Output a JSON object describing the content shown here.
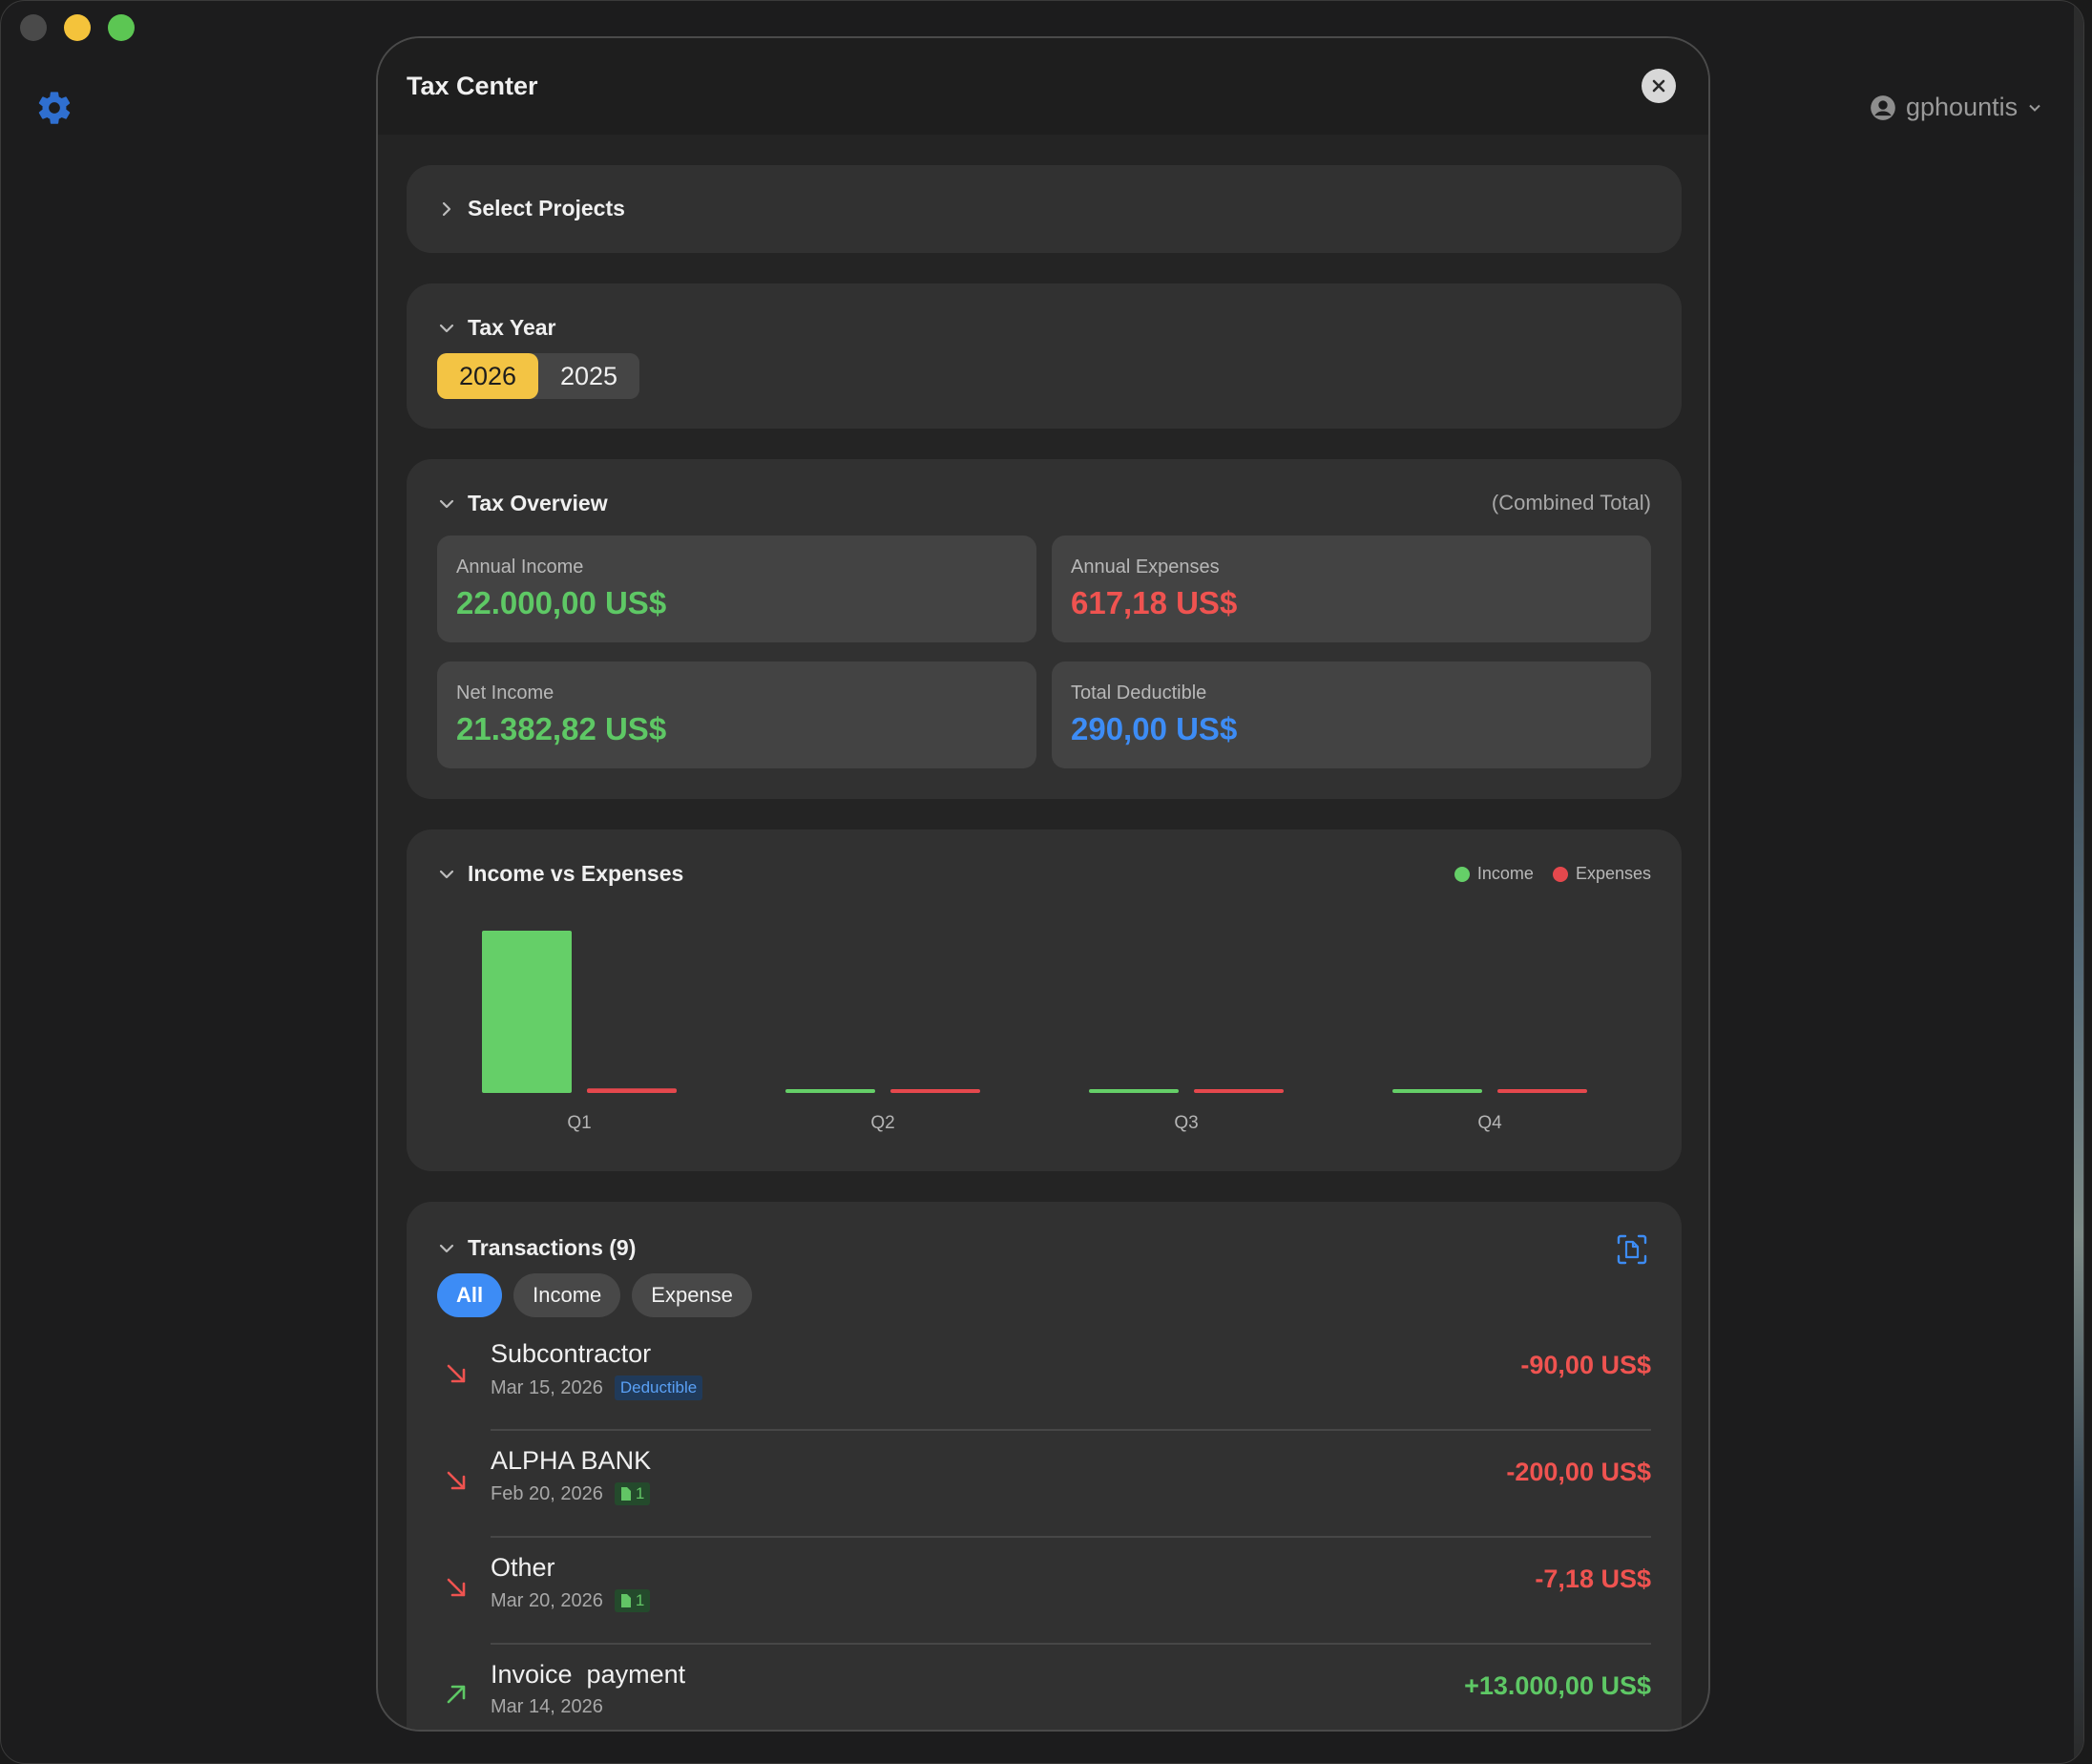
{
  "window": {
    "user_name": "gphountis"
  },
  "modal": {
    "title": "Tax Center"
  },
  "projects": {
    "title": "Select Projects"
  },
  "tax_year": {
    "title": "Tax Year",
    "options": [
      "2026",
      "2025"
    ],
    "selected": "2026"
  },
  "overview": {
    "title": "Tax Overview",
    "scope": "(Combined Total)",
    "stats": [
      {
        "label": "Annual Income",
        "value": "22.000,00 US$",
        "color": "#5ec865"
      },
      {
        "label": "Annual Expenses",
        "value": "617,18 US$",
        "color": "#ef5350"
      },
      {
        "label": "Net Income",
        "value": "21.382,82 US$",
        "color": "#5ec865"
      },
      {
        "label": "Total Deductible",
        "value": "290,00 US$",
        "color": "#3d8cf5"
      }
    ]
  },
  "income_vs_expenses": {
    "title": "Income vs Expenses",
    "legend": [
      {
        "name": "Income",
        "color": "#65cf68"
      },
      {
        "name": "Expenses",
        "color": "#e5484d"
      }
    ]
  },
  "chart_data": {
    "type": "bar",
    "categories": [
      "Q1",
      "Q2",
      "Q3",
      "Q4"
    ],
    "series": [
      {
        "name": "Income",
        "color": "#65cf68",
        "values": [
          22000,
          0,
          0,
          0
        ]
      },
      {
        "name": "Expenses",
        "color": "#e5484d",
        "values": [
          617.18,
          0,
          0,
          0
        ]
      }
    ],
    "ylim": [
      0,
      22000
    ],
    "grid": false,
    "legend": "top-right"
  },
  "transactions": {
    "title": "Transactions (9)",
    "filters": [
      "All",
      "Income",
      "Expense"
    ],
    "active_filter": "All",
    "items": [
      {
        "name": "Subcontractor",
        "date": "Mar 15, 2026",
        "badge": "Deductible",
        "files": null,
        "amount": "-90,00 US$",
        "direction": "out"
      },
      {
        "name": "ALPHA BANK",
        "date": "Feb 20, 2026",
        "badge": null,
        "files": "1",
        "amount": "-200,00 US$",
        "direction": "out"
      },
      {
        "name": "Other",
        "date": "Mar 20, 2026",
        "badge": null,
        "files": "1",
        "amount": "-7,18 US$",
        "direction": "out"
      },
      {
        "name": "Invoice  payment",
        "date": "Mar 14, 2026",
        "badge": null,
        "files": null,
        "amount": "+13.000,00 US$",
        "direction": "in"
      }
    ]
  }
}
